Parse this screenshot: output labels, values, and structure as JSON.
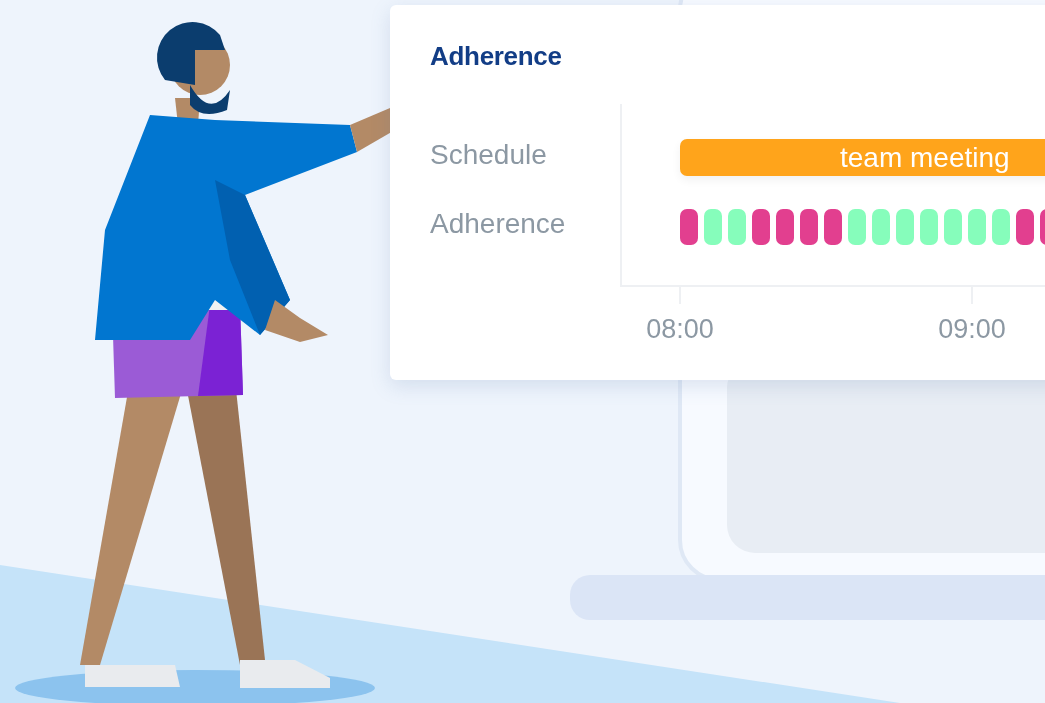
{
  "card": {
    "title": "Adherence"
  },
  "schedule": {
    "label": "Schedule",
    "event": {
      "label": "team meeting",
      "color": "#ffa41b"
    }
  },
  "adherence": {
    "label": "Adherence",
    "segments": [
      {
        "color": "#e23f8f"
      },
      {
        "color": "#86fdbb"
      },
      {
        "color": "#86fdbb"
      },
      {
        "color": "#e23f8f"
      },
      {
        "color": "#e23f8f"
      },
      {
        "color": "#e23f8f"
      },
      {
        "color": "#e23f8f"
      },
      {
        "color": "#86fdbb"
      },
      {
        "color": "#86fdbb"
      },
      {
        "color": "#86fdbb"
      },
      {
        "color": "#86fdbb"
      },
      {
        "color": "#86fdbb"
      },
      {
        "color": "#86fdbb"
      },
      {
        "color": "#86fdbb"
      },
      {
        "color": "#e23f8f"
      },
      {
        "color": "#e23f8f"
      }
    ]
  },
  "axis": {
    "ticks": [
      "08:00",
      "09:00"
    ]
  }
}
